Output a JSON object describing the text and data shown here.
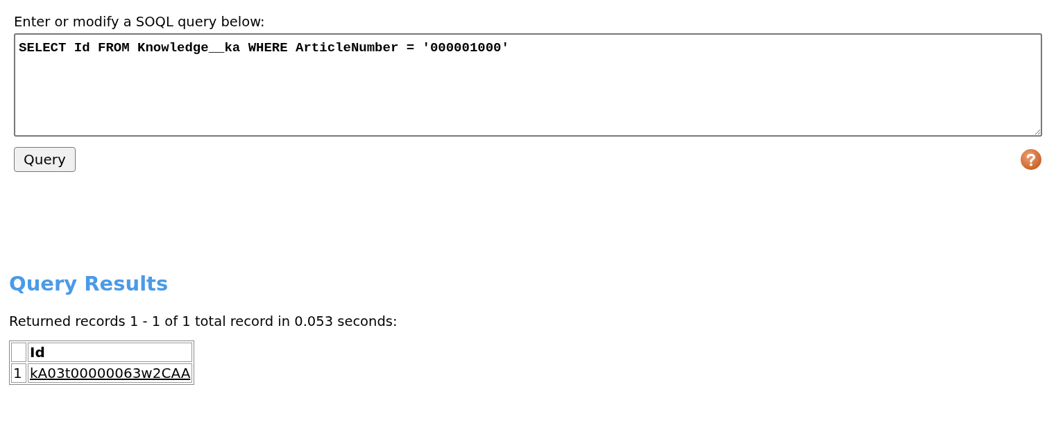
{
  "query_form": {
    "label": "Enter or modify a SOQL query below:",
    "value": "SELECT Id FROM Knowledge__ka WHERE ArticleNumber = '000001000'",
    "button": "Query"
  },
  "results": {
    "heading": "Query Results",
    "summary": "Returned records 1 - 1 of 1 total record in 0.053 seconds:",
    "table": {
      "columns": [
        "Id"
      ],
      "rows": [
        {
          "number": "1",
          "cells": [
            "kA03t00000063w2CAA"
          ]
        }
      ]
    }
  }
}
